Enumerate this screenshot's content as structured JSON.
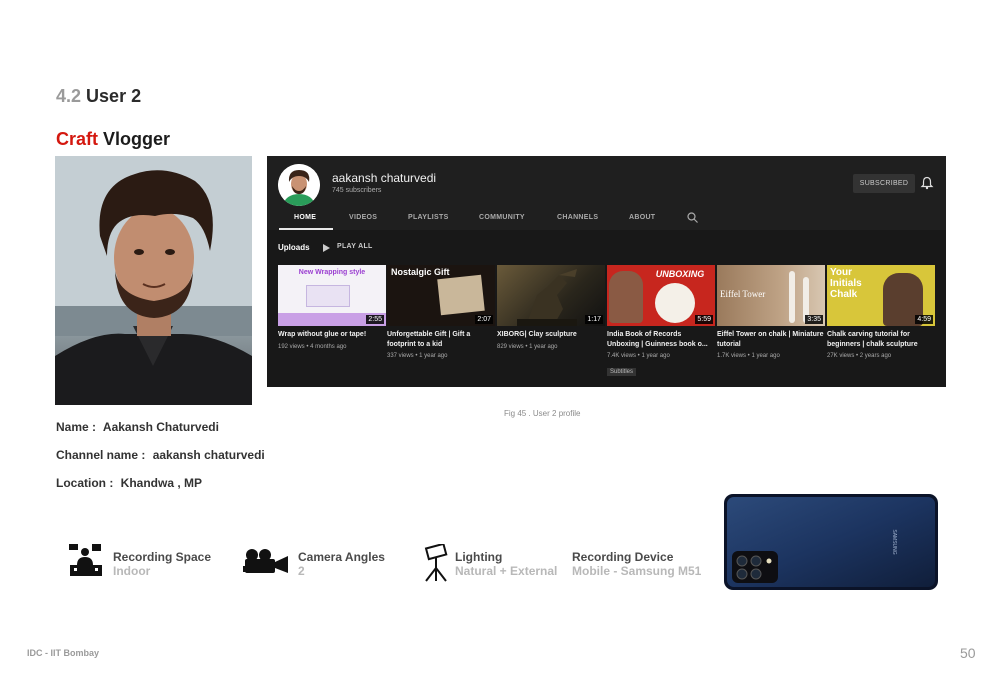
{
  "section": {
    "number": "4.2",
    "title": "User 2"
  },
  "subtitle": {
    "accent": "Craft",
    "rest": "Vlogger"
  },
  "info": [
    {
      "label": "Name :",
      "value": "Aakansh Chaturvedi"
    },
    {
      "label": "Channel name :",
      "value": "aakansh chaturvedi"
    },
    {
      "label": "Location :",
      "value": "Khandwa , MP"
    }
  ],
  "channel": {
    "name": "aakansh chaturvedi",
    "subscribers": "745 subscribers",
    "subscribe_label": "SUBSCRIBED",
    "tabs": [
      "HOME",
      "VIDEOS",
      "PLAYLISTS",
      "COMMUNITY",
      "CHANNELS",
      "ABOUT"
    ],
    "uploads_label": "Uploads",
    "play_all_label": "PLAY ALL",
    "videos": [
      {
        "thumb_text": "New Wrapping style",
        "duration": "2:55",
        "title": "Wrap without glue or tape!",
        "meta": "192 views • 4 months ago"
      },
      {
        "thumb_text": "Nostalgic Gift",
        "duration": "2:07",
        "title": "Unforgettable Gift | Gift a footprint to a kid",
        "meta": "337 views • 1 year ago"
      },
      {
        "thumb_text": "",
        "duration": "1:17",
        "title": "XIBORG| Clay sculpture",
        "meta": "829 views • 1 year ago"
      },
      {
        "thumb_text": "UNBOXING",
        "duration": "5:59",
        "title": "India Book of Records Unboxing | Guinness book o...",
        "meta": "7.4K views • 1 year ago",
        "badge": "Subtitles"
      },
      {
        "thumb_text": "Eiffel Tower",
        "duration": "3:35",
        "title": "Eiffel Tower on chalk | Miniature tutorial",
        "meta": "1.7K views • 1 year ago"
      },
      {
        "thumb_text": "Your Initials Chalk",
        "duration": "4:59",
        "title": "Chalk carving tutorial for beginners | chalk sculpture",
        "meta": "27K views • 2 years ago"
      }
    ]
  },
  "caption": "Fig 45 . User 2 profile",
  "features": [
    {
      "icon": "recording-space-icon",
      "label": "Recording Space",
      "value": "Indoor"
    },
    {
      "icon": "camera-icon",
      "label": "Camera Angles",
      "value": "2"
    },
    {
      "icon": "lighting-icon",
      "label": "Lighting",
      "value": "Natural + External"
    },
    {
      "label": "Recording Device",
      "value": "Mobile - Samsung M51"
    }
  ],
  "phone_brand": "SAMSUNG",
  "footer": {
    "left": "IDC - IIT Bombay",
    "page": "50"
  },
  "colors": {
    "accent": "#d4180f",
    "yt_bg": "#181818",
    "muted": "#9a9a9a"
  }
}
